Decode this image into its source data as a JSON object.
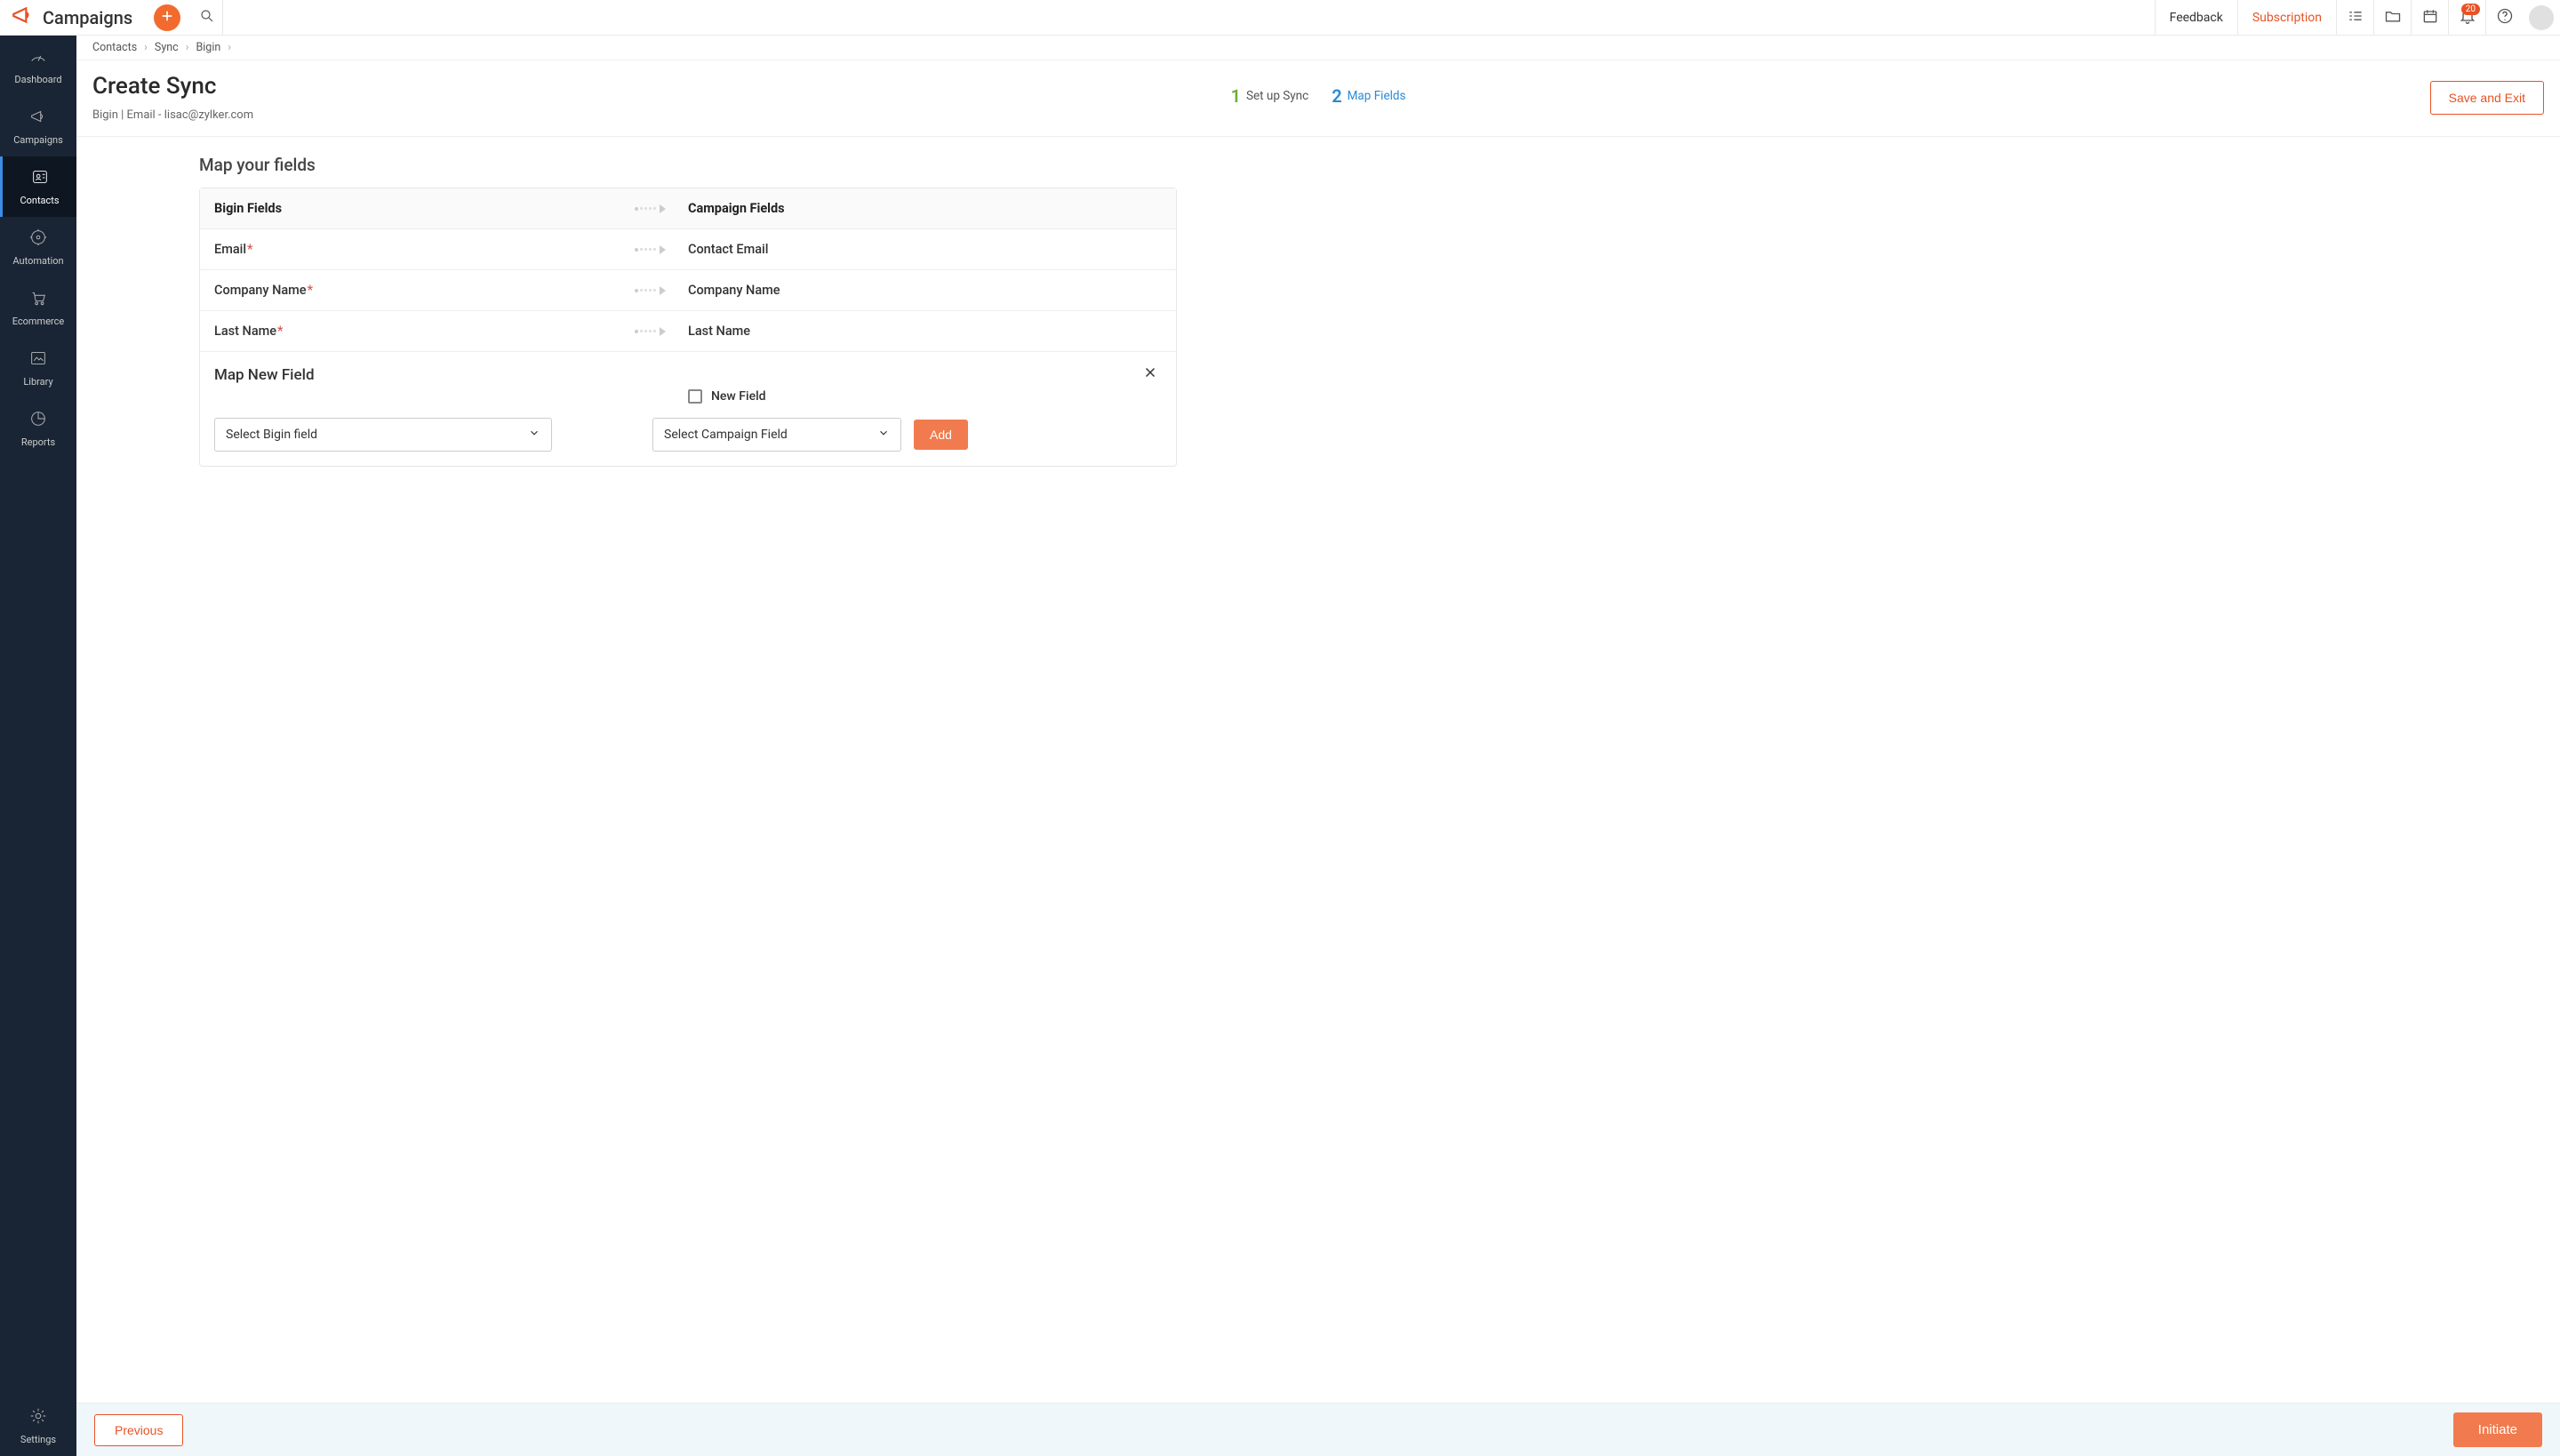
{
  "brand": {
    "name": "Campaigns"
  },
  "top_nav": {
    "feedback": "Feedback",
    "subscription": "Subscription",
    "notif_count": "20"
  },
  "sidebar": {
    "items": [
      {
        "label": "Dashboard"
      },
      {
        "label": "Campaigns"
      },
      {
        "label": "Contacts"
      },
      {
        "label": "Automation"
      },
      {
        "label": "Ecommerce"
      },
      {
        "label": "Library"
      },
      {
        "label": "Reports"
      }
    ],
    "settings_label": "Settings"
  },
  "breadcrumb": {
    "items": [
      "Contacts",
      "Sync",
      "Bigin"
    ]
  },
  "page": {
    "title": "Create Sync",
    "subtitle": "Bigin | Email - lisac@zylker.com",
    "save_exit": "Save and Exit",
    "steps": [
      {
        "num": "1",
        "label": "Set up Sync"
      },
      {
        "num": "2",
        "label": "Map Fields"
      }
    ]
  },
  "map": {
    "section_title": "Map your fields",
    "col_left": "Bigin Fields",
    "col_right": "Campaign Fields",
    "rows": [
      {
        "left": "Email",
        "required": true,
        "right": "Contact Email"
      },
      {
        "left": "Company Name",
        "required": true,
        "right": "Company Name"
      },
      {
        "left": "Last Name",
        "required": true,
        "right": "Last Name"
      }
    ],
    "new_field": {
      "title": "Map New Field",
      "checkbox_label": "New Field",
      "bigin_placeholder": "Select Bigin field",
      "campaign_placeholder": "Select Campaign Field",
      "add_label": "Add"
    }
  },
  "footer": {
    "previous": "Previous",
    "initiate": "Initiate"
  }
}
